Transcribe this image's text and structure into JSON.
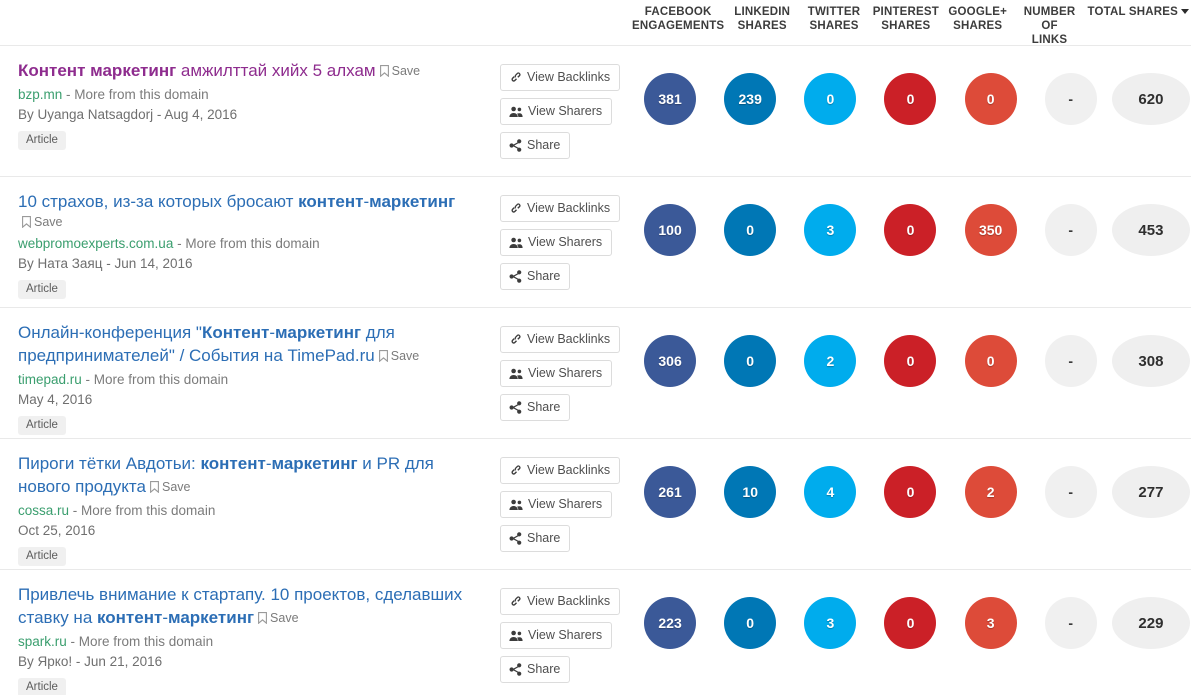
{
  "columns": [
    {
      "id": "facebook",
      "label": "FACEBOOK ENGAGEMENTS",
      "line1": "FACEBOOK",
      "line2": "ENGAGEMENTS",
      "color": "#3b5998"
    },
    {
      "id": "linkedin",
      "label": "LINKEDIN SHARES",
      "line1": "LINKEDIN",
      "line2": "SHARES",
      "color": "#0077b5"
    },
    {
      "id": "twitter",
      "label": "TWITTER SHARES",
      "line1": "TWITTER",
      "line2": "SHARES",
      "color": "#00aced"
    },
    {
      "id": "pinterest",
      "label": "PINTEREST SHARES",
      "line1": "PINTEREST",
      "line2": "SHARES",
      "color": "#cb2027"
    },
    {
      "id": "googleplus",
      "label": "GOOGLE+ SHARES",
      "line1": "GOOGLE+",
      "line2": "SHARES",
      "color": "#dd4b39"
    },
    {
      "id": "links",
      "label": "NUMBER OF LINKS",
      "line1": "NUMBER OF",
      "line2": "LINKS",
      "color": "#f0f0f0"
    },
    {
      "id": "total",
      "label": "TOTAL SHARES",
      "line1": "TOTAL SHARES",
      "line2": "",
      "color": "#efefef",
      "sort_indicator": "caret-down"
    }
  ],
  "actions": {
    "backlinks_label": "View Backlinks",
    "sharers_label": "View Sharers",
    "share_label": "Share"
  },
  "save_label": "Save",
  "type_badge": "Article",
  "domain_suffix": "More from this domain",
  "rows": [
    {
      "title_parts": [
        {
          "text": "Контент маркетинг",
          "bold": true
        },
        {
          "text": " амжилттай хийх 5 алхам",
          "bold": false
        }
      ],
      "title_plain": "Контент маркетинг амжилттай хийх 5 алхам",
      "visited": true,
      "save_inline": true,
      "domain": "bzp.mn",
      "byline": "By Uyanga Natsagdorj - Aug 4, 2016",
      "badge": "Article",
      "metrics": {
        "facebook": "381",
        "linkedin": "239",
        "twitter": "0",
        "pinterest": "0",
        "googleplus": "0",
        "links": "-",
        "total": "620"
      }
    },
    {
      "title_parts": [
        {
          "text": "10 страхов, из-за которых бросают ",
          "bold": false
        },
        {
          "text": "контент",
          "bold": true
        },
        {
          "text": "-",
          "bold": false
        },
        {
          "text": "маркетинг",
          "bold": true
        }
      ],
      "title_plain": "10 страхов, из-за которых бросают контент-маркетинг",
      "visited": false,
      "save_inline": false,
      "domain": "webpromoexperts.com.ua",
      "byline": "By Ната Заяц - Jun 14, 2016",
      "badge": "Article",
      "metrics": {
        "facebook": "100",
        "linkedin": "0",
        "twitter": "3",
        "pinterest": "0",
        "googleplus": "350",
        "links": "-",
        "total": "453"
      }
    },
    {
      "title_parts": [
        {
          "text": "Онлайн-конференция \"",
          "bold": false
        },
        {
          "text": "Контент",
          "bold": true
        },
        {
          "text": "-",
          "bold": false
        },
        {
          "text": "маркетинг",
          "bold": true
        },
        {
          "text": " для предпринимателей\" / События на TimePad.ru",
          "bold": false
        }
      ],
      "title_plain": "Онлайн-конференция \"Контент-маркетинг для предпринимателей\" / События на TimePad.ru",
      "visited": false,
      "save_inline": true,
      "domain": "timepad.ru",
      "byline": "May 4, 2016",
      "badge": "Article",
      "metrics": {
        "facebook": "306",
        "linkedin": "0",
        "twitter": "2",
        "pinterest": "0",
        "googleplus": "0",
        "links": "-",
        "total": "308"
      }
    },
    {
      "title_parts": [
        {
          "text": "Пироги тётки Авдотьи: ",
          "bold": false
        },
        {
          "text": "контент",
          "bold": true
        },
        {
          "text": "-",
          "bold": false
        },
        {
          "text": "маркетинг",
          "bold": true
        },
        {
          "text": " и PR для нового продукта",
          "bold": false
        }
      ],
      "title_plain": "Пироги тётки Авдотьи: контент-маркетинг и PR для нового продукта",
      "visited": false,
      "save_inline": true,
      "domain": "cossa.ru",
      "byline": "Oct 25, 2016",
      "badge": "Article",
      "metrics": {
        "facebook": "261",
        "linkedin": "10",
        "twitter": "4",
        "pinterest": "0",
        "googleplus": "2",
        "links": "-",
        "total": "277"
      }
    },
    {
      "title_parts": [
        {
          "text": "Привлечь внимание к стартапу. 10 проектов, сделавших ставку на ",
          "bold": false
        },
        {
          "text": "контент",
          "bold": true
        },
        {
          "text": "-",
          "bold": false
        },
        {
          "text": "маркетинг",
          "bold": true
        }
      ],
      "title_plain": "Привлечь внимание к стартапу. 10 проектов, сделавших ставку на контент-маркетинг",
      "visited": false,
      "save_inline": true,
      "domain": "spark.ru",
      "byline": "By Ярко! - Jun 21, 2016",
      "badge": "Article",
      "metrics": {
        "facebook": "223",
        "linkedin": "0",
        "twitter": "3",
        "pinterest": "0",
        "googleplus": "3",
        "links": "-",
        "total": "229"
      }
    }
  ]
}
